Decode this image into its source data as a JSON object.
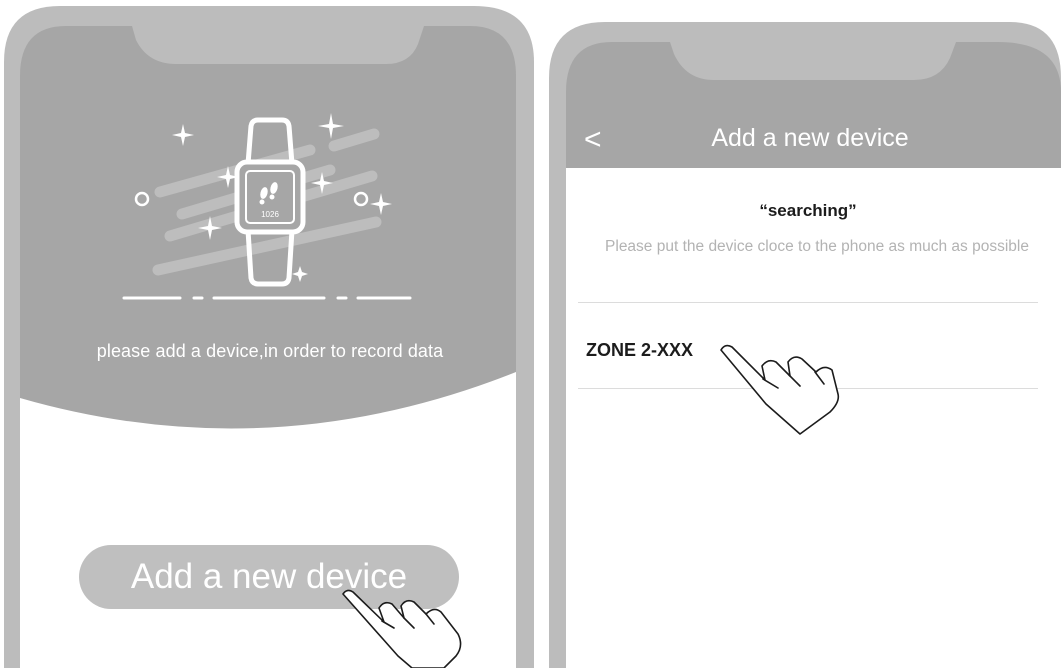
{
  "left_screen": {
    "illustration": {
      "icons": [
        "smartwatch-icon",
        "footsteps-icon",
        "sparkle-icon"
      ],
      "watch_steps": "1026"
    },
    "hint": "please add a device,in order to record data",
    "add_button_label": "Add a new device",
    "pointer_icon": "hand-pointer-icon"
  },
  "right_screen": {
    "header": {
      "back_label": "<",
      "title": "Add a new device"
    },
    "search_title": "“searching”",
    "search_desc": "Please put the device cloce to the phone as much as possible",
    "devices": [
      {
        "name": "ZONE 2-XXX"
      }
    ],
    "pointer_icon": "hand-pointer-icon"
  },
  "colors": {
    "phone_frame": "#bcbcbc",
    "phone_header": "#a6a6a6",
    "button": "#bfbfbf",
    "text_on_gray": "#ffffff",
    "text_dark": "#1c1c1c",
    "text_hint": "#b3b3b3"
  }
}
